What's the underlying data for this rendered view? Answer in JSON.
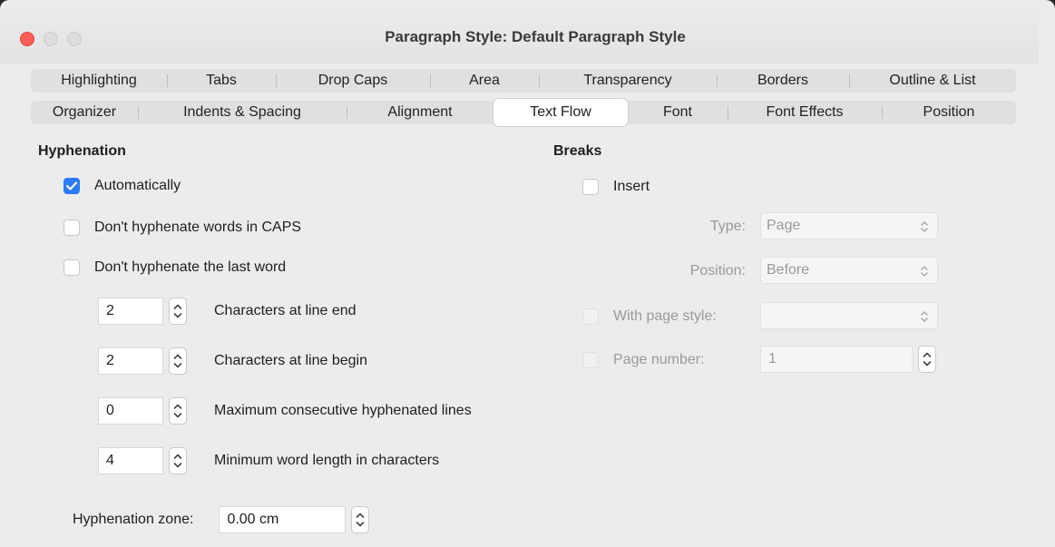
{
  "window": {
    "title": "Paragraph Style: Default Paragraph Style"
  },
  "tabs_row1": [
    {
      "label": "Highlighting"
    },
    {
      "label": "Tabs"
    },
    {
      "label": "Drop Caps"
    },
    {
      "label": "Area"
    },
    {
      "label": "Transparency"
    },
    {
      "label": "Borders"
    },
    {
      "label": "Outline & List"
    }
  ],
  "tabs_row2": [
    {
      "label": "Organizer"
    },
    {
      "label": "Indents & Spacing"
    },
    {
      "label": "Alignment"
    },
    {
      "label": "Text Flow",
      "active": true
    },
    {
      "label": "Font"
    },
    {
      "label": "Font Effects"
    },
    {
      "label": "Position"
    }
  ],
  "hyphenation": {
    "title": "Hyphenation",
    "automatically": {
      "label": "Automatically",
      "checked": true
    },
    "no_caps": {
      "label": "Don't hyphenate words in CAPS",
      "checked": false
    },
    "no_last_word": {
      "label": "Don't hyphenate the last word",
      "checked": false
    },
    "chars_line_end": {
      "value": "2",
      "label": "Characters at line end"
    },
    "chars_line_begin": {
      "value": "2",
      "label": "Characters at line begin"
    },
    "max_consecutive": {
      "value": "0",
      "label": "Maximum consecutive hyphenated lines"
    },
    "min_word_length": {
      "value": "4",
      "label": "Minimum word length in characters"
    },
    "zone": {
      "label": "Hyphenation zone:",
      "value": "0.00 cm"
    }
  },
  "breaks": {
    "title": "Breaks",
    "insert": {
      "label": "Insert",
      "checked": false
    },
    "type": {
      "label": "Type:",
      "value": "Page"
    },
    "position": {
      "label": "Position:",
      "value": "Before"
    },
    "with_page_style": {
      "label": "With page style:",
      "value": ""
    },
    "page_number": {
      "label": "Page number:",
      "value": "1"
    }
  },
  "colors": {
    "accent": "#2b7cf6",
    "close": "#fe5f57"
  }
}
